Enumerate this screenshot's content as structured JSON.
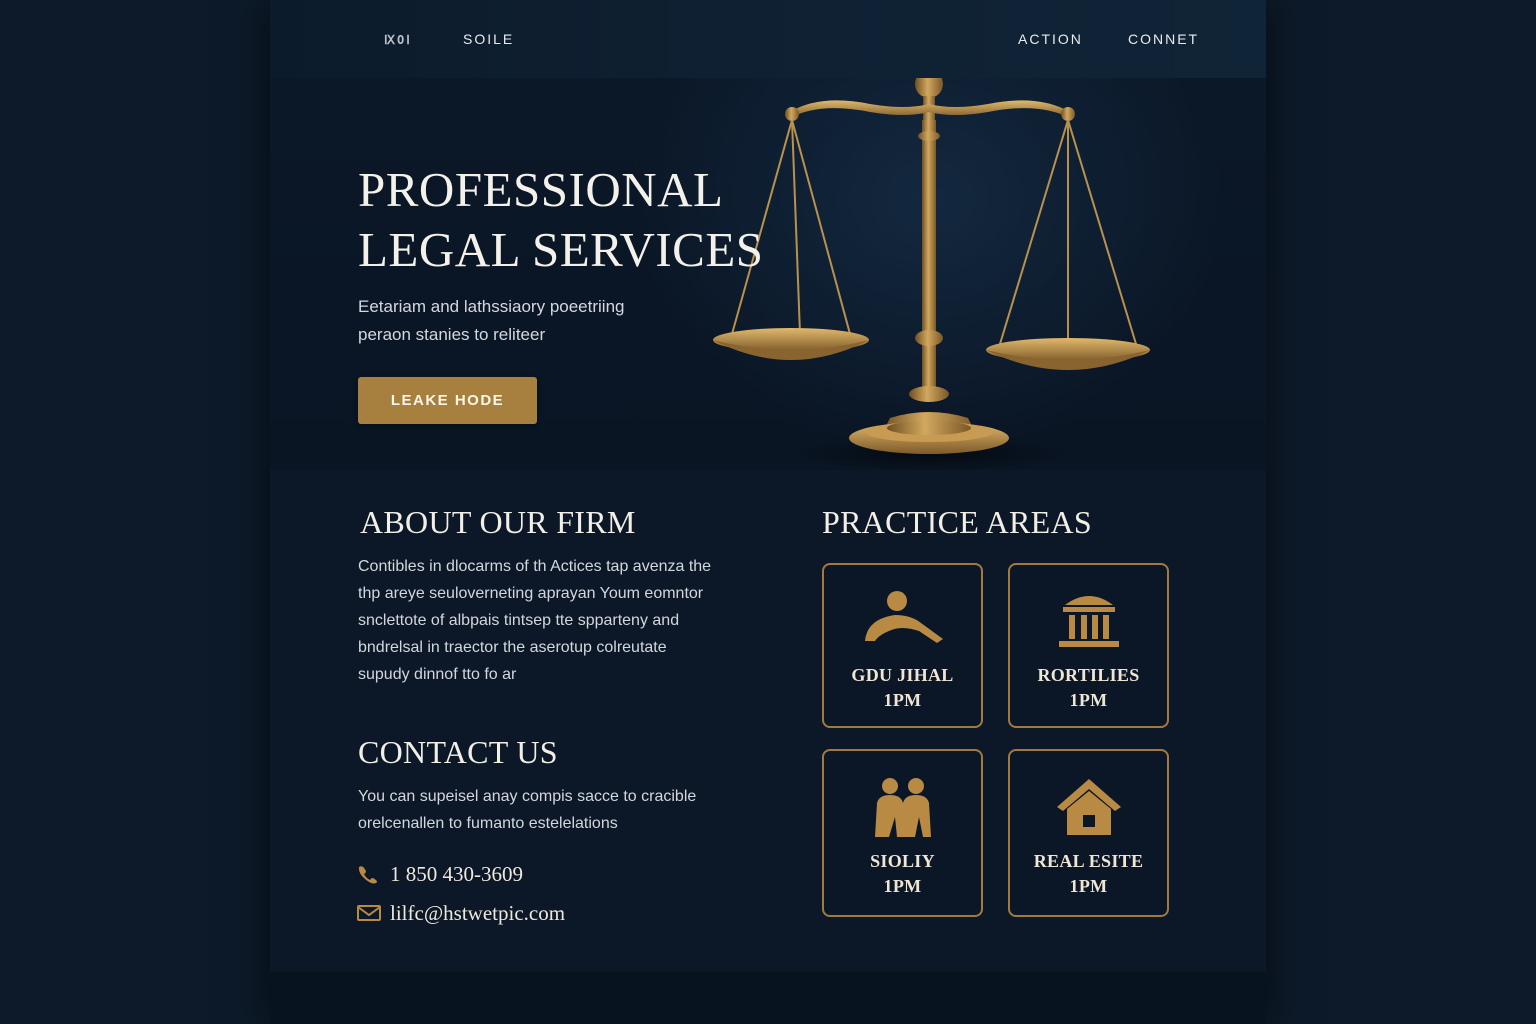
{
  "nav": {
    "logo": "ⅨOⅠ",
    "links": [
      "SOILE",
      "ACTION",
      "CONNET"
    ]
  },
  "hero": {
    "title_line1": "PROFESSIONAL",
    "title_line2": "LEGAL SERVICES",
    "subtitle_line1": "Eetariam and lathssiaory poeetriing",
    "subtitle_line2": "peraon stanies to reliteer",
    "cta_label": "LEAKE HODE",
    "image_icon": "scales-of-justice-icon"
  },
  "about": {
    "heading": "ABOUT OUR FIRM",
    "lines": [
      "Contibles in dlocarms of th Actices tap avenza the",
      "thp areye seuloverneting aprayan   Youm eomntor",
      "snclettote of albpais tintsep tte spparteny and",
      "bndrelsal in traector the aserotup colreutate",
      "supudy dinnof tto fo ar"
    ]
  },
  "contact": {
    "heading": "CONTACT US",
    "lines": [
      "You can supeisel anay compis sacce to cracible",
      "orelcenallen to fumanto estelelations"
    ],
    "phone": "1 850 430-3609",
    "email": "lilfc@hstwetpic.com",
    "phone_icon": "phone-icon",
    "email_icon": "envelope-icon"
  },
  "practice": {
    "heading": "PRACTICE AREAS",
    "cards": [
      {
        "title": "GDU JIHAL",
        "sub": "1PM",
        "icon": "reclining-figure-icon"
      },
      {
        "title": "RORTILIES",
        "sub": "1PM",
        "icon": "courthouse-icon"
      },
      {
        "title": "SIOLIY",
        "sub": "1PM",
        "icon": "family-icon"
      },
      {
        "title": "REAL ESITE",
        "sub": "1PM",
        "icon": "house-icon"
      }
    ]
  },
  "colors": {
    "background": "#0b1726",
    "accent_gold": "#a7803f",
    "text_light": "#f3f1ea"
  }
}
